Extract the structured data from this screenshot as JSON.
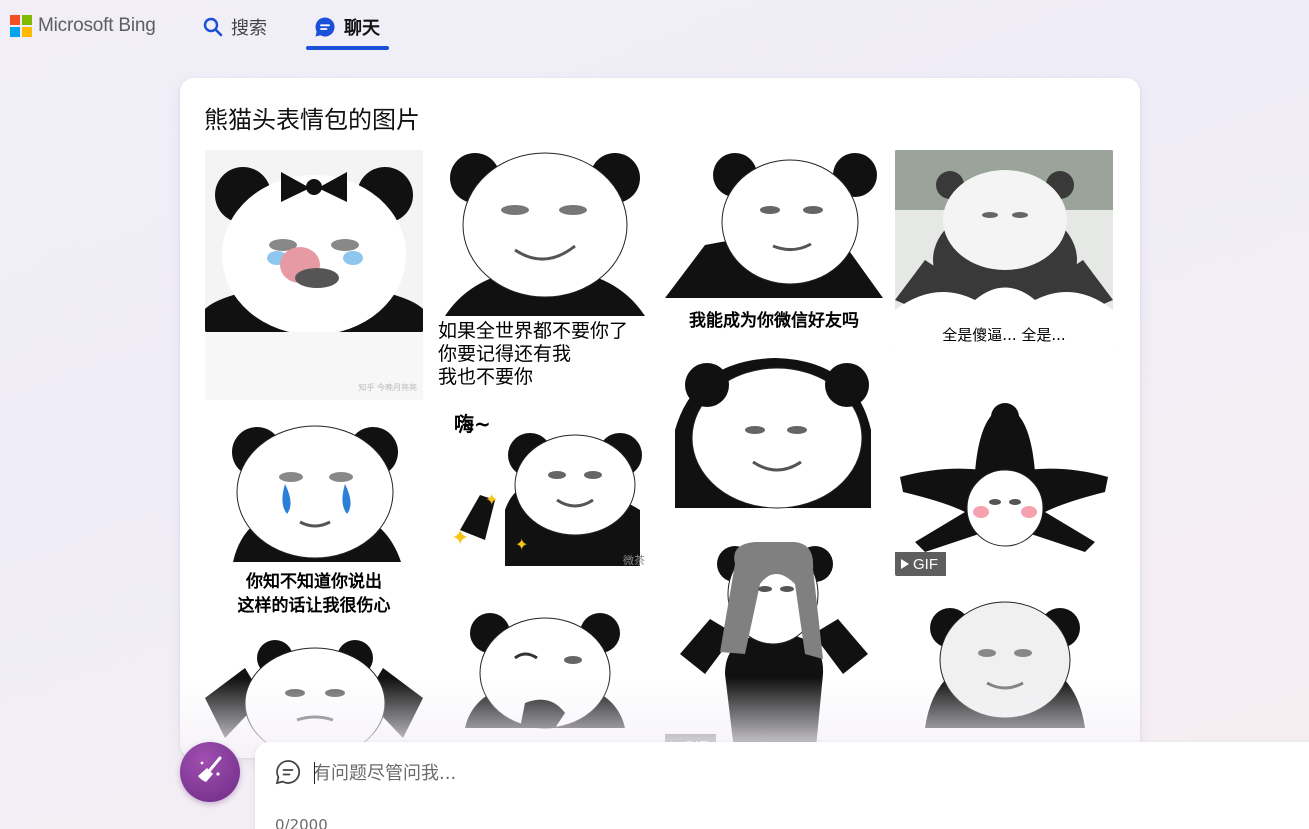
{
  "header": {
    "brand": "Microsoft Bing",
    "logo_colors": [
      "#f25022",
      "#7fba00",
      "#00a4ef",
      "#ffb900"
    ],
    "tabs": [
      {
        "label": "搜索",
        "icon": "search-icon",
        "active": false
      },
      {
        "label": "聊天",
        "icon": "chat-bubble-icon",
        "active": true
      }
    ],
    "accent": "#1a4fd8"
  },
  "card": {
    "title": "熊猫头表情包的图片",
    "images": [
      {
        "caption": "",
        "watermark": "知乎 今晚月亮亮"
      },
      {
        "caption": "你知不知道你说出\n这样的话让我很伤心"
      },
      {
        "caption": ""
      },
      {
        "caption": "如果全世界都不要你了\n你要记得还有我\n我也不要你"
      },
      {
        "caption": "嗨~",
        "watermark": "微茶"
      },
      {
        "caption": ""
      },
      {
        "caption": "我能成为你微信好友吗"
      },
      {
        "caption": ""
      },
      {
        "caption": "",
        "badge": "GIF"
      },
      {
        "caption": "全是傻逼... 全是..."
      },
      {
        "caption": "",
        "badge": "GIF"
      },
      {
        "caption": ""
      }
    ]
  },
  "composer": {
    "placeholder": "有问题尽管问我...",
    "value": "",
    "counter": "0/2000",
    "new_topic_icon": "broom-icon",
    "input_icon": "chat-icon"
  }
}
